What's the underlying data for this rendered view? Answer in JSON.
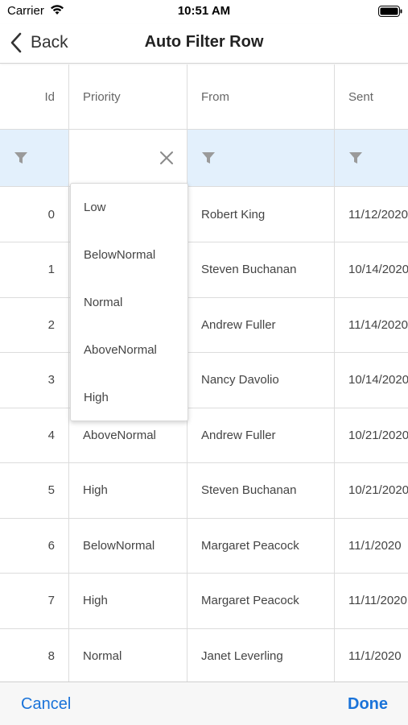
{
  "status_bar": {
    "carrier": "Carrier",
    "time": "10:51 AM",
    "icons": [
      "wifi-icon",
      "battery-icon"
    ]
  },
  "nav": {
    "back_label": "Back",
    "title": "Auto Filter Row"
  },
  "grid": {
    "columns": [
      "Id",
      "Priority",
      "From",
      "Sent"
    ],
    "filter_icons": [
      "funnel-icon",
      "close-icon"
    ],
    "rows": [
      {
        "id": "0",
        "priority": "",
        "from": "Robert King",
        "sent": "11/12/2020"
      },
      {
        "id": "1",
        "priority": "",
        "from": "Steven Buchanan",
        "sent": "10/14/2020"
      },
      {
        "id": "2",
        "priority": "",
        "from": "Andrew Fuller",
        "sent": "11/14/2020"
      },
      {
        "id": "3",
        "priority": "",
        "from": "Nancy Davolio",
        "sent": "10/14/2020"
      },
      {
        "id": "4",
        "priority": "AboveNormal",
        "from": "Andrew Fuller",
        "sent": "10/21/2020"
      },
      {
        "id": "5",
        "priority": "High",
        "from": "Steven Buchanan",
        "sent": "10/21/2020"
      },
      {
        "id": "6",
        "priority": "BelowNormal",
        "from": "Margaret Peacock",
        "sent": "11/1/2020"
      },
      {
        "id": "7",
        "priority": "High",
        "from": "Margaret Peacock",
        "sent": "11/11/2020"
      },
      {
        "id": "8",
        "priority": "Normal",
        "from": "Janet Leverling",
        "sent": "11/1/2020"
      }
    ]
  },
  "dropdown": {
    "options": [
      "Low",
      "BelowNormal",
      "Normal",
      "AboveNormal",
      "High"
    ]
  },
  "toolbar": {
    "cancel_label": "Cancel",
    "done_label": "Done"
  },
  "colors": {
    "accent": "#1a73d9",
    "filter_row_bg": "#e3f0fc",
    "grid_line": "#dcdcdc",
    "icon_gray": "#9a9a9a"
  }
}
